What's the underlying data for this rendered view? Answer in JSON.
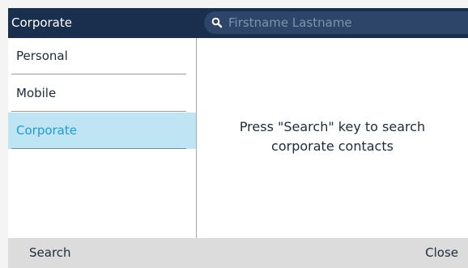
{
  "header": {
    "title": "Corporate"
  },
  "search": {
    "placeholder": "Firstname Lastname",
    "icon": "search-icon"
  },
  "sidebar": {
    "items": [
      {
        "label": "Personal",
        "selected": false
      },
      {
        "label": "Mobile",
        "selected": false
      },
      {
        "label": "Corporate",
        "selected": true
      }
    ]
  },
  "main": {
    "message_line1": "Press \"Search\" key to search",
    "message_line2": "corporate contacts"
  },
  "softkeys": {
    "left": "Search",
    "right": "Close"
  },
  "colors": {
    "header_bg": "#1a2e4d",
    "selected_bg": "#bfe4f4",
    "selected_text": "#1f9ad6",
    "softkey_bar_bg": "#dcdcdc"
  }
}
